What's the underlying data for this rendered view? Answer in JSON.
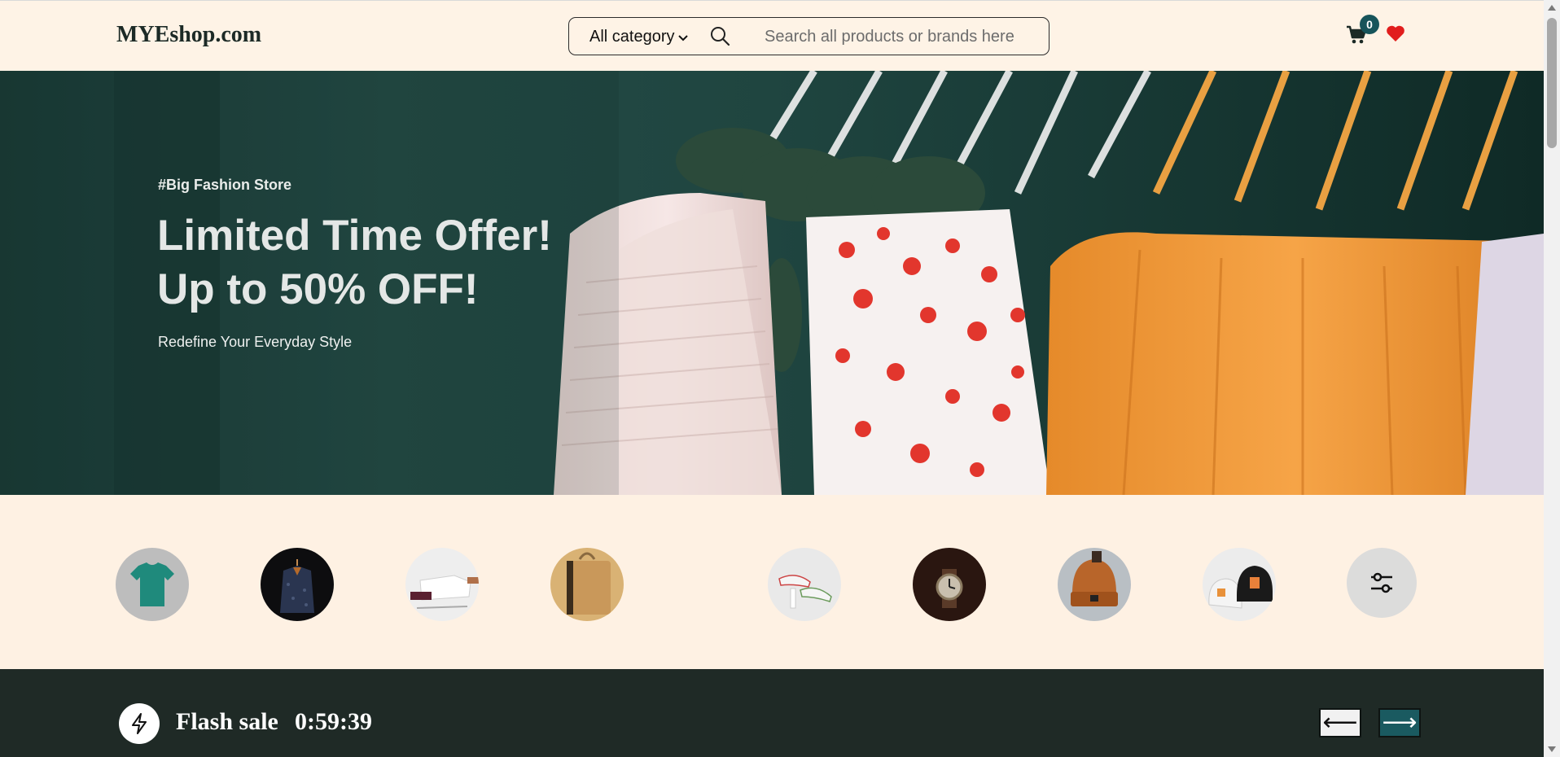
{
  "header": {
    "logo": "MYEshop.com",
    "category_label": "All category",
    "search_placeholder": "Search all products or brands here",
    "cart_count": "0"
  },
  "hero": {
    "tag": "#Big Fashion Store",
    "title_line1": "Limited Time Offer!",
    "title_line2": "Up to 50% OFF!",
    "subtitle": "Redefine Your Everyday Style"
  },
  "categories": {
    "icons": [
      "tshirt-icon",
      "jacket-icon",
      "shirt-icon",
      "bag-icon",
      "sneaker-icon",
      "watch-icon",
      "beanie-icon",
      "cap-icon",
      "filter-icon"
    ]
  },
  "flash_sale": {
    "title": "Flash sale",
    "timer": "0:59:39",
    "prev_label": "⟵",
    "next_label": "⟶"
  },
  "colors": {
    "page_bg": "#fef1e3",
    "accent": "#1a5a60",
    "flash_bg": "#1f2a26",
    "heart": "#e11d1d"
  }
}
